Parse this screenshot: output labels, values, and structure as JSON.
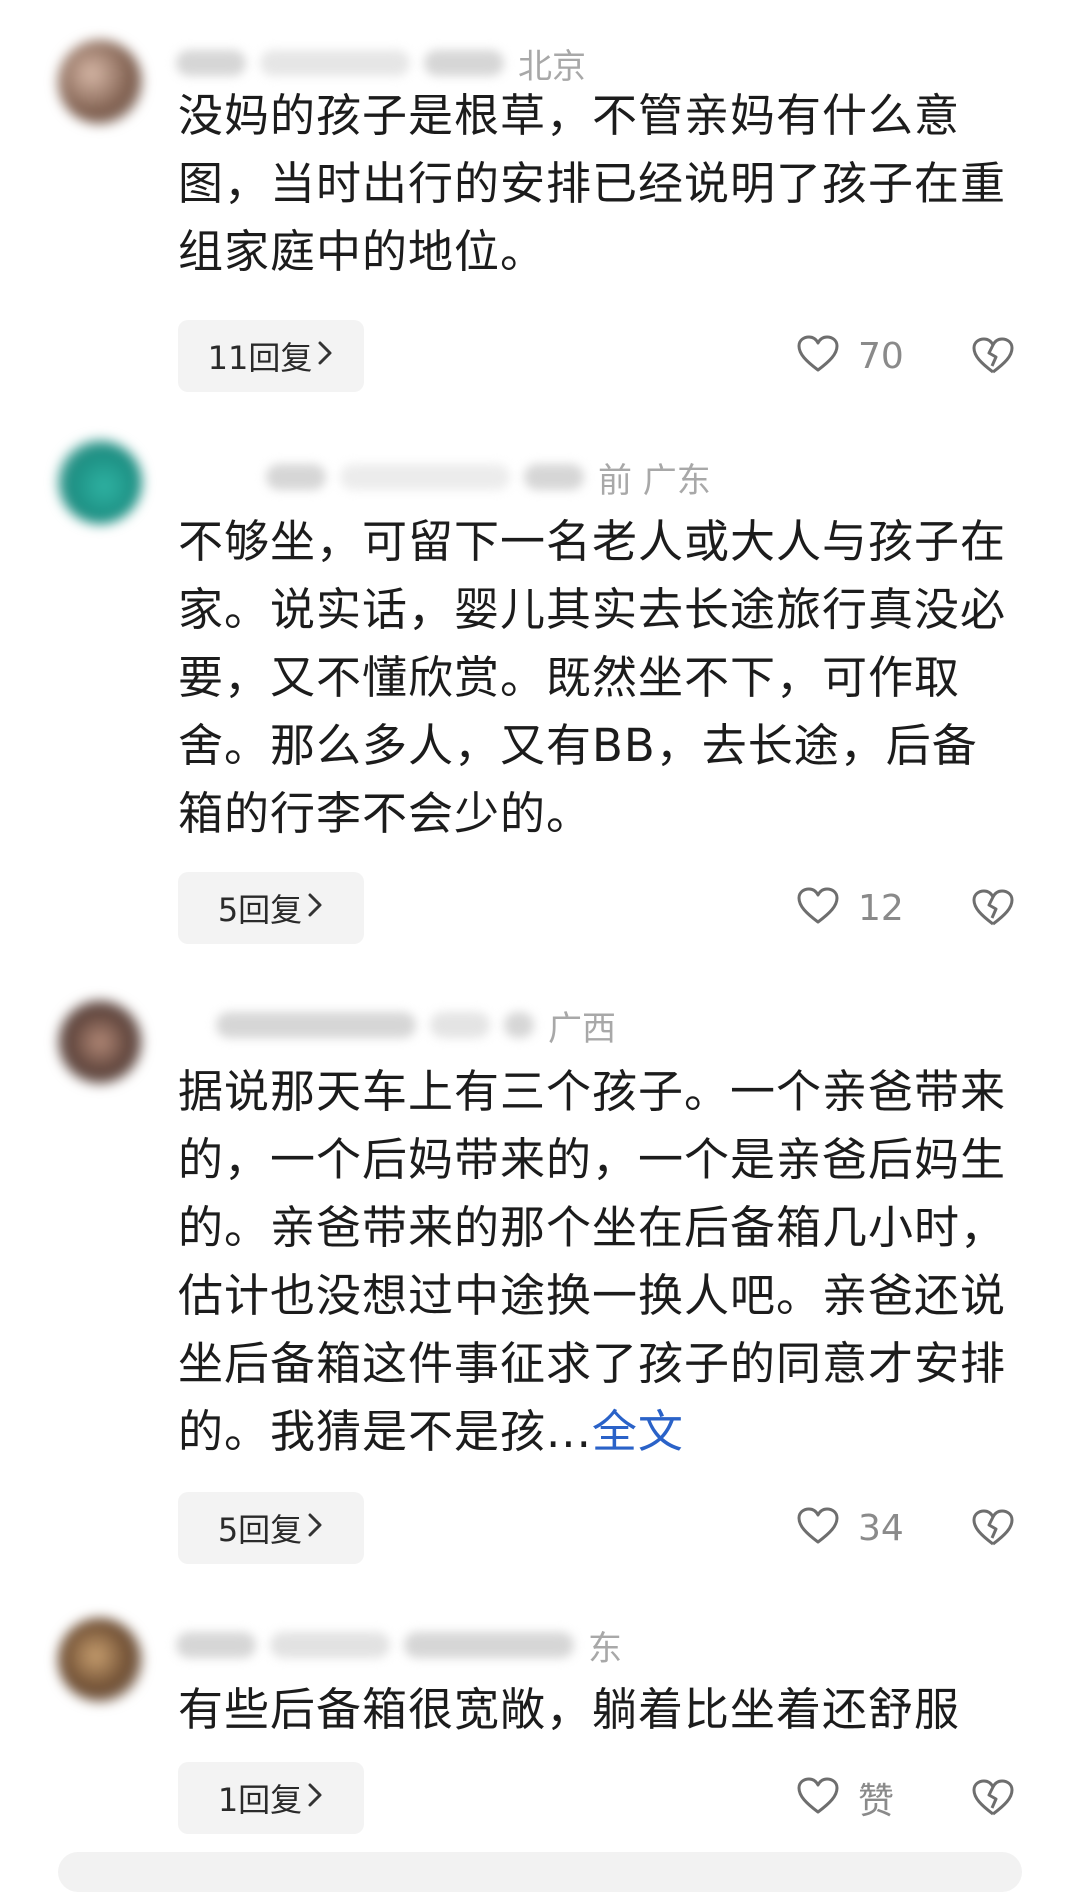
{
  "comments": [
    {
      "meta": "北京",
      "text": "没妈的孩子是根草，不管亲妈有什么意图，当时出行的安排已经说明了孩子在重组家庭中的地位。",
      "link": "",
      "reply_label": "11回复",
      "like_label": "70"
    },
    {
      "meta": "前  广东",
      "text": "不够坐，可留下一名老人或大人与孩子在家。说实话，婴儿其实去长途旅行真没必要，又不懂欣赏。既然坐不下，可作取舍。那么多人，又有BB，去长途，后备箱的行李不会少的。",
      "link": "",
      "reply_label": "5回复",
      "like_label": "12"
    },
    {
      "meta": "广西",
      "text": "据说那天车上有三个孩子。一个亲爸带来的，一个后妈带来的，一个是亲爸后妈生的。亲爸带来的那个坐在后备箱几小时，估计也没想过中途换一换人吧。亲爸还说坐后备箱这件事征求了孩子的同意才安排的。我猜是不是孩...",
      "link": "全文",
      "reply_label": "5回复",
      "like_label": "34"
    },
    {
      "meta": "东",
      "text": "有些后备箱很宽敞，躺着比坐着还舒服",
      "link": "",
      "reply_label": "1回复",
      "like_label": "赞"
    }
  ],
  "icons": {
    "chevron": "chevron-right-icon",
    "like": "heart-outline-icon",
    "dislike": "broken-heart-icon"
  },
  "colors": {
    "link": "#2a62c8",
    "meta": "#a8a8a8",
    "pill_bg": "#f3f3f3"
  }
}
